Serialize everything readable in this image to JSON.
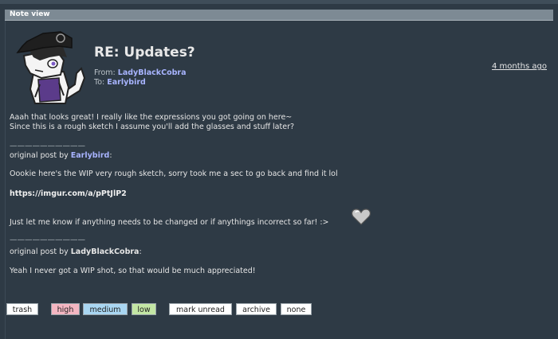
{
  "panel": {
    "header": "Note view"
  },
  "note": {
    "title": "RE: Updates?",
    "time": "4 months ago",
    "from_label": "From:",
    "from_user": "LadyBlackCobra",
    "to_label": "To:",
    "to_user": "Earlybird",
    "lines": {
      "l1": "Aaah that looks great! I really like the expressions you got going on here~",
      "l2": "Since this is a rough sketch I assume you'll add the glasses and stuff later?",
      "sep1": "——————————",
      "orig1_prefix": "original post by ",
      "orig1_user": "Earlybird",
      "orig1_suffix": ":",
      "l3": "Oookie here's the WIP very rough sketch, sorry took me a sec to go back and find it lol",
      "link": "https://imgur.com/a/pPtJlP2",
      "l4": "Just let me know if anything needs to be changed or if anythings incorrect so far! :>",
      "sep2": "——————————",
      "orig2_prefix": "original post by ",
      "orig2_user": "LadyBlackCobra",
      "orig2_suffix": ":",
      "l5": "Yeah I never got a WIP shot, so that would be much appreciated!"
    }
  },
  "actions": {
    "trash": "trash",
    "high": "high",
    "medium": "medium",
    "low": "low",
    "mark_unread": "mark unread",
    "archive": "archive",
    "none": "none"
  },
  "colors": {
    "background": "#2e3a45",
    "header": "#7d8a94",
    "username": "#a8b4ff",
    "high": "#f4b6c2",
    "medium": "#a9d6f2",
    "low": "#c3e6a4"
  }
}
